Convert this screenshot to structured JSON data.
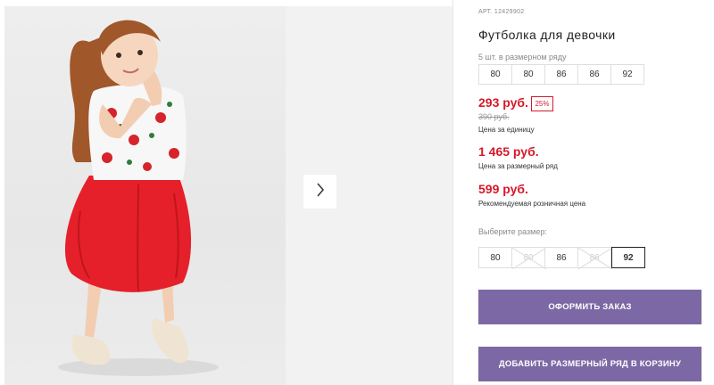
{
  "product": {
    "article": "АРТ. 12429902",
    "title": "Футболка для девочки",
    "set_label": "5 шт. в размерном ряду",
    "set_sizes": [
      "80",
      "80",
      "86",
      "86",
      "92"
    ],
    "price_unit": "293 руб.",
    "discount_badge": "25%",
    "old_price": "390 руб.",
    "price_unit_caption": "Цена за единицу",
    "price_set": "1 465 руб.",
    "price_set_caption": "Цена за размерный ряд",
    "price_retail": "599 руб.",
    "price_retail_caption": "Рекомендуемая розничная цена"
  },
  "size_picker": {
    "label": "Выберите размер:",
    "options": [
      {
        "label": "80",
        "state": "available"
      },
      {
        "label": "80",
        "state": "disabled"
      },
      {
        "label": "86",
        "state": "available"
      },
      {
        "label": "86",
        "state": "disabled"
      },
      {
        "label": "92",
        "state": "selected"
      }
    ]
  },
  "actions": {
    "order_label": "ОФОРМИТЬ ЗАКАЗ",
    "cart_label": "ДОБАВИТЬ РАЗМЕРНЫЙ РЯД В КОРЗИНУ"
  },
  "gallery": {
    "next_icon": "chevron-right-icon"
  },
  "colors": {
    "accent_button": "#7c68a5",
    "price_red": "#d6192a"
  }
}
